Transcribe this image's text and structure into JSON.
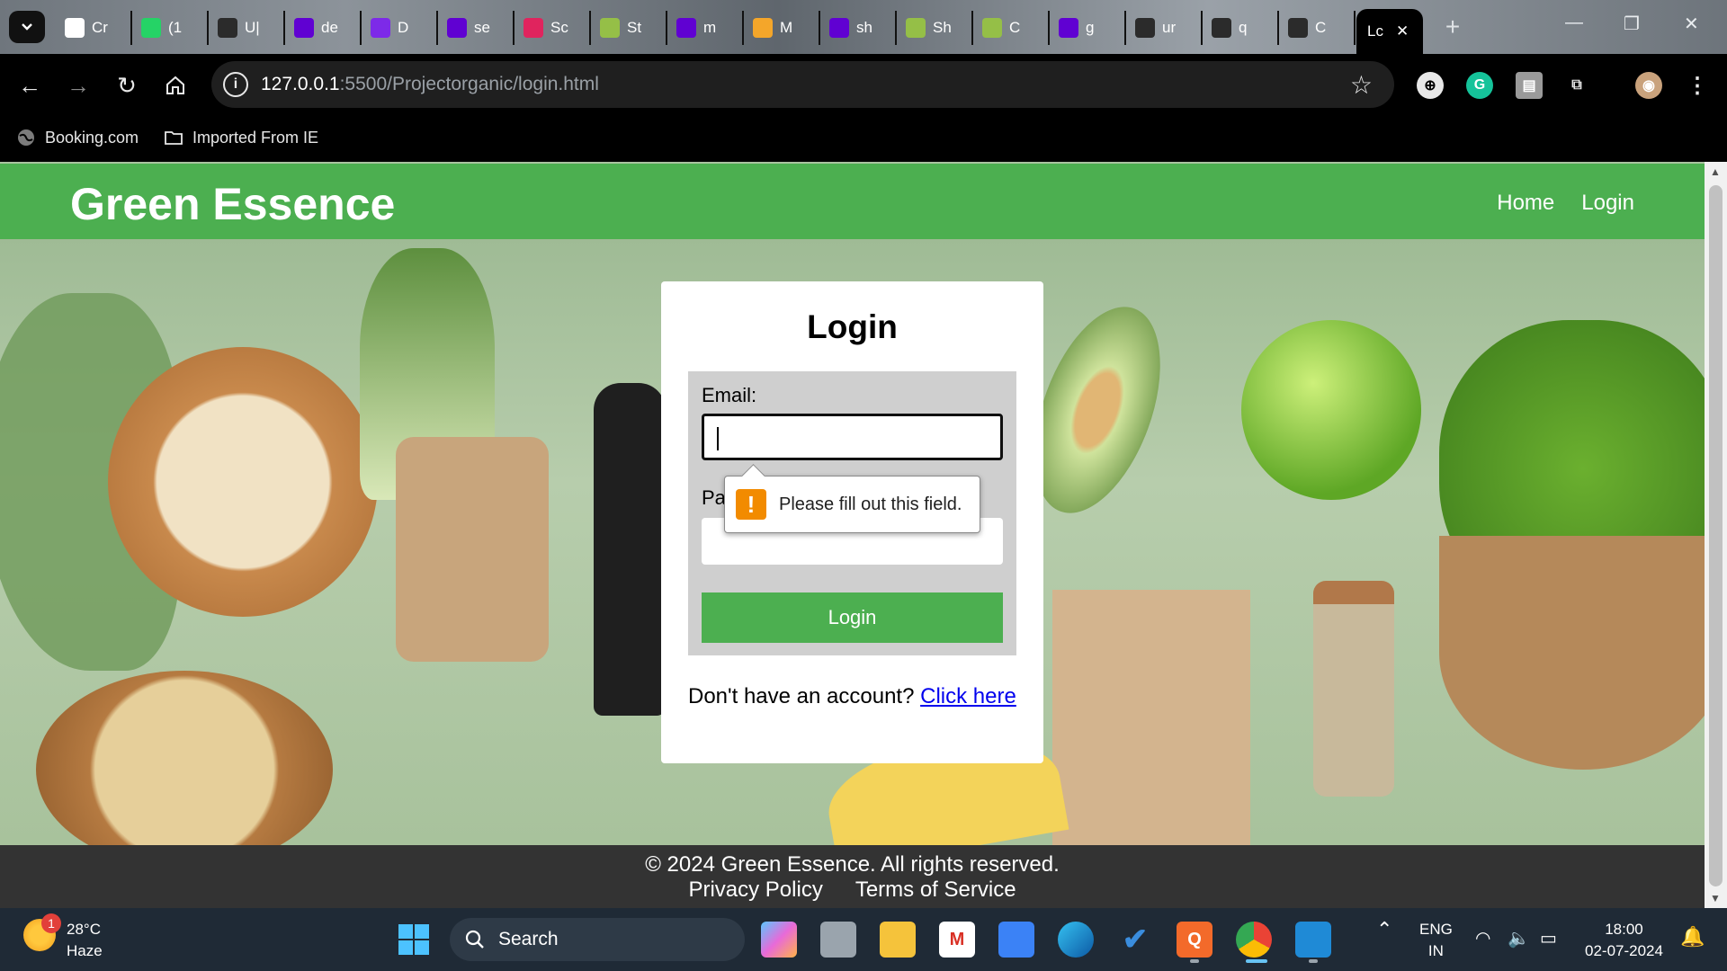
{
  "browser": {
    "tabs": [
      {
        "icon": "chatgpt-icon",
        "label": "Cr",
        "color": "#ffffff"
      },
      {
        "icon": "whatsapp-icon",
        "label": "(1",
        "color": "#25d366"
      },
      {
        "icon": "github-icon",
        "label": "U|",
        "color": "#2b2b2b"
      },
      {
        "icon": "yahoo-icon",
        "label": "de",
        "color": "#6001d2"
      },
      {
        "icon": "canva-icon",
        "label": "D",
        "color": "#7d2ae8"
      },
      {
        "icon": "yahoo-icon",
        "label": "se",
        "color": "#6001d2"
      },
      {
        "icon": "app-icon",
        "label": "Sc",
        "color": "#e0245e"
      },
      {
        "icon": "shopify-icon",
        "label": "St",
        "color": "#95bf47"
      },
      {
        "icon": "yahoo-icon",
        "label": "m",
        "color": "#6001d2"
      },
      {
        "icon": "figma-icon",
        "label": "M",
        "color": "#f4a62a"
      },
      {
        "icon": "yahoo-icon",
        "label": "sh",
        "color": "#6001d2"
      },
      {
        "icon": "shopify-icon",
        "label": "Sh",
        "color": "#95bf47"
      },
      {
        "icon": "shopify-icon",
        "label": "C",
        "color": "#95bf47"
      },
      {
        "icon": "yahoo-icon",
        "label": "g",
        "color": "#6001d2"
      },
      {
        "icon": "github-icon",
        "label": "ur",
        "color": "#2b2b2b"
      },
      {
        "icon": "github-icon",
        "label": "q",
        "color": "#2b2b2b"
      },
      {
        "icon": "github-icon",
        "label": "C",
        "color": "#2b2b2b"
      }
    ],
    "active_tab": {
      "label": "Lc",
      "close": "✕"
    },
    "new_tab": "+",
    "url_host": "127.0.0.1",
    "url_rest": ":5500/Projectorganic/login.html",
    "bookmarks": [
      {
        "icon": "globe-icon",
        "label": "Booking.com"
      },
      {
        "icon": "folder-icon",
        "label": "Imported From IE"
      }
    ]
  },
  "site": {
    "brand": "Green Essence",
    "nav": [
      "Home",
      "Login"
    ],
    "accent": "#4caf50"
  },
  "login": {
    "title": "Login",
    "email_label": "Email:",
    "password_label": "Pa",
    "button": "Login",
    "signup_text": "Don't have an account?",
    "signup_link": "Click here",
    "validation_message": "Please fill out this field."
  },
  "footer": {
    "copyright": "© 2024 Green Essence. All rights reserved.",
    "links": [
      "Privacy Policy",
      "Terms of Service"
    ]
  },
  "taskbar": {
    "weather_temp": "28°C",
    "weather_desc": "Haze",
    "weather_badge": "1",
    "search_label": "Search",
    "lang_top": "ENG",
    "lang_bottom": "IN",
    "time": "18:00",
    "date": "02-07-2024"
  }
}
